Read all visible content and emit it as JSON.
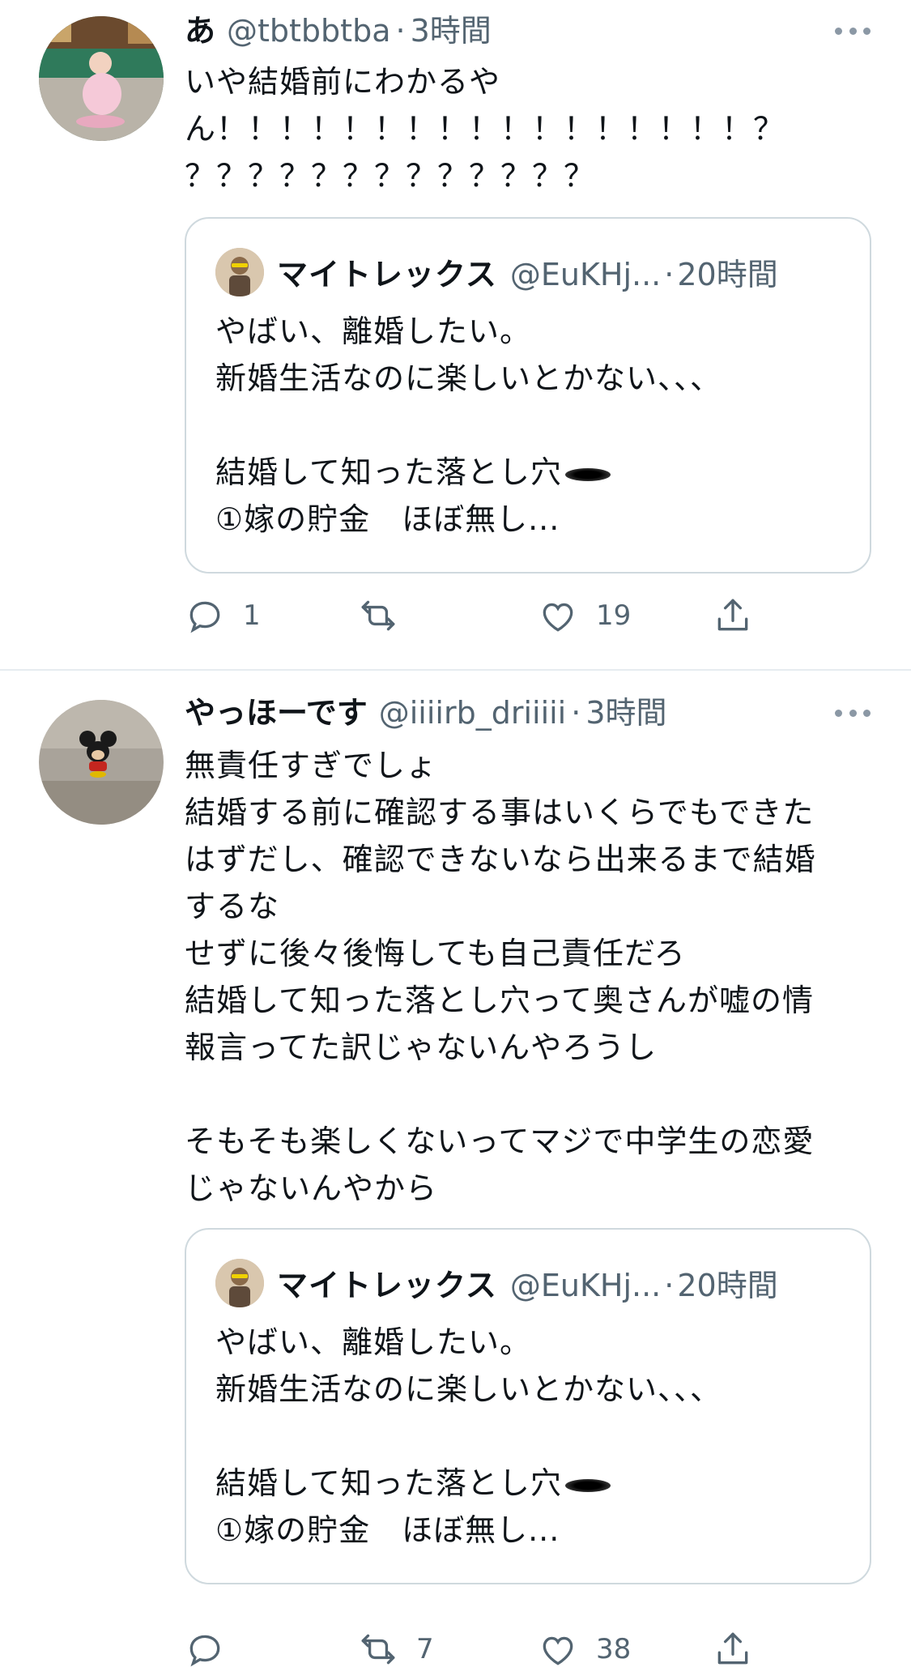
{
  "tweets": [
    {
      "display_name": "あ",
      "handle": "@tbtbbtba",
      "separator": "·",
      "time": "3時間",
      "text_lines": [
        "いや結婚前にわかるや",
        "ん！！！！！！！！！！！！！！！！！？",
        "？？？？？？？？？？？？？"
      ],
      "quote": {
        "display_name": "マイトレックス",
        "handle": "@EuKHj...",
        "separator": "·",
        "time": "20時間",
        "lines": [
          "やばい、離婚したい。",
          "新婚生活なのに楽しいとかない、、、",
          "",
          "結婚して知った落とし穴",
          "①嫁の貯金　ほぼ無し..."
        ]
      },
      "actions": {
        "reply_count": "1",
        "retweet_count": "",
        "like_count": "19"
      }
    },
    {
      "display_name": "やっほーです",
      "handle": "@iiiirb_driiiii",
      "separator": "·",
      "time": "3時間",
      "text_lines": [
        "無責任すぎでしょ",
        "結婚する前に確認する事はいくらでもできた",
        "はずだし、確認できないなら出来るまで結婚",
        "するな",
        "せずに後々後悔しても自己責任だろ",
        "結婚して知った落とし穴って奥さんが嘘の情",
        "報言ってた訳じゃないんやろうし",
        "",
        "そもそも楽しくないってマジで中学生の恋愛",
        "じゃないんやから"
      ],
      "quote": {
        "display_name": "マイトレックス",
        "handle": "@EuKHj...",
        "separator": "·",
        "time": "20時間",
        "lines": [
          "やばい、離婚したい。",
          "新婚生活なのに楽しいとかない、、、",
          "",
          "結婚して知った落とし穴",
          "①嫁の貯金　ほぼ無し..."
        ]
      },
      "actions": {
        "reply_count": "",
        "retweet_count": "7",
        "like_count": "38"
      }
    }
  ],
  "icons": [
    "more-icon",
    "reply-icon",
    "retweet-icon",
    "like-icon",
    "share-icon",
    "hole-emoji-icon"
  ],
  "colors": {
    "text": "#0f1419",
    "secondary": "#536471",
    "border": "#cfd9de",
    "divider": "#e6ecf0"
  }
}
